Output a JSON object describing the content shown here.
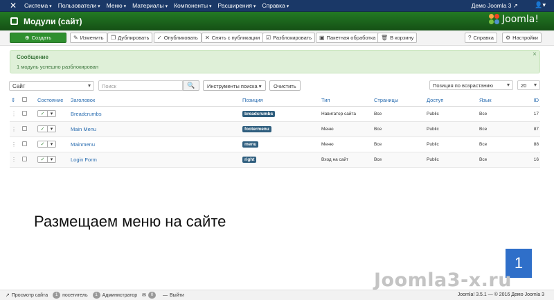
{
  "topnav": {
    "menu": [
      "Система",
      "Пользователи",
      "Меню",
      "Материалы",
      "Компоненты",
      "Расширения",
      "Справка"
    ],
    "site_link": "Демо Joomla 3 ↗",
    "user_icon": "user-icon"
  },
  "header": {
    "title": "Модули (сайт)",
    "brand": "Joomla!"
  },
  "toolbar": {
    "create": "Создать",
    "edit": "Изменить",
    "duplicate": "Дублировать",
    "publish": "Опубликовать",
    "unpublish": "Снять с публикации",
    "unlock": "Разблокировать",
    "batch": "Пакетная обработка",
    "trash": "В корзину",
    "help": "Справка",
    "options": "Настройки"
  },
  "alert": {
    "title": "Сообщение",
    "message": "1 модуль успешно разблокирован"
  },
  "filters": {
    "client": "Сайт",
    "search_placeholder": "Поиск",
    "search_tools": "Инструменты поиска",
    "clear": "Очистить",
    "ordering": "Позиция по возрастанию",
    "limit": "20"
  },
  "table": {
    "headers": {
      "state": "Состояние",
      "title": "Заголовок",
      "position": "Позиция",
      "type": "Тип",
      "pages": "Страницы",
      "access": "Доступ",
      "language": "Язык",
      "id": "ID"
    },
    "rows": [
      {
        "title": "Breadcrumbs",
        "position": "breadcrumbs",
        "type": "Навигатор сайта",
        "pages": "Все",
        "access": "Public",
        "language": "Все",
        "id": "17"
      },
      {
        "title": "Main Menu",
        "position": "footermenu",
        "type": "Меню",
        "pages": "Все",
        "access": "Public",
        "language": "Все",
        "id": "87"
      },
      {
        "title": "Mainmenu",
        "position": "menu",
        "type": "Меню",
        "pages": "Все",
        "access": "Public",
        "language": "Все",
        "id": "88"
      },
      {
        "title": "Login Form",
        "position": "right",
        "type": "Вход на сайт",
        "pages": "Все",
        "access": "Public",
        "language": "Все",
        "id": "16"
      }
    ]
  },
  "caption": "Размещаем меню на сайте",
  "badge": "1",
  "watermark": "Joomla3-x.ru",
  "statusbar": {
    "view_site": "Просмотр сайта",
    "visitors_count": "1",
    "visitors": "посетитель",
    "admins_count": "1",
    "admins": "Администратор",
    "messages_count": "0",
    "logout": "Выйти",
    "version": "Joomla! 3.5.1 — © 2016 Демо Joomla 3"
  },
  "colors": {
    "topnav": "#1a3867",
    "header": "#1e6a1e",
    "create_button": "#2f8f2f",
    "alert_bg": "#dff0d8",
    "position_badge": "#2f5e7e",
    "page_badge": "#2f6fc9"
  }
}
